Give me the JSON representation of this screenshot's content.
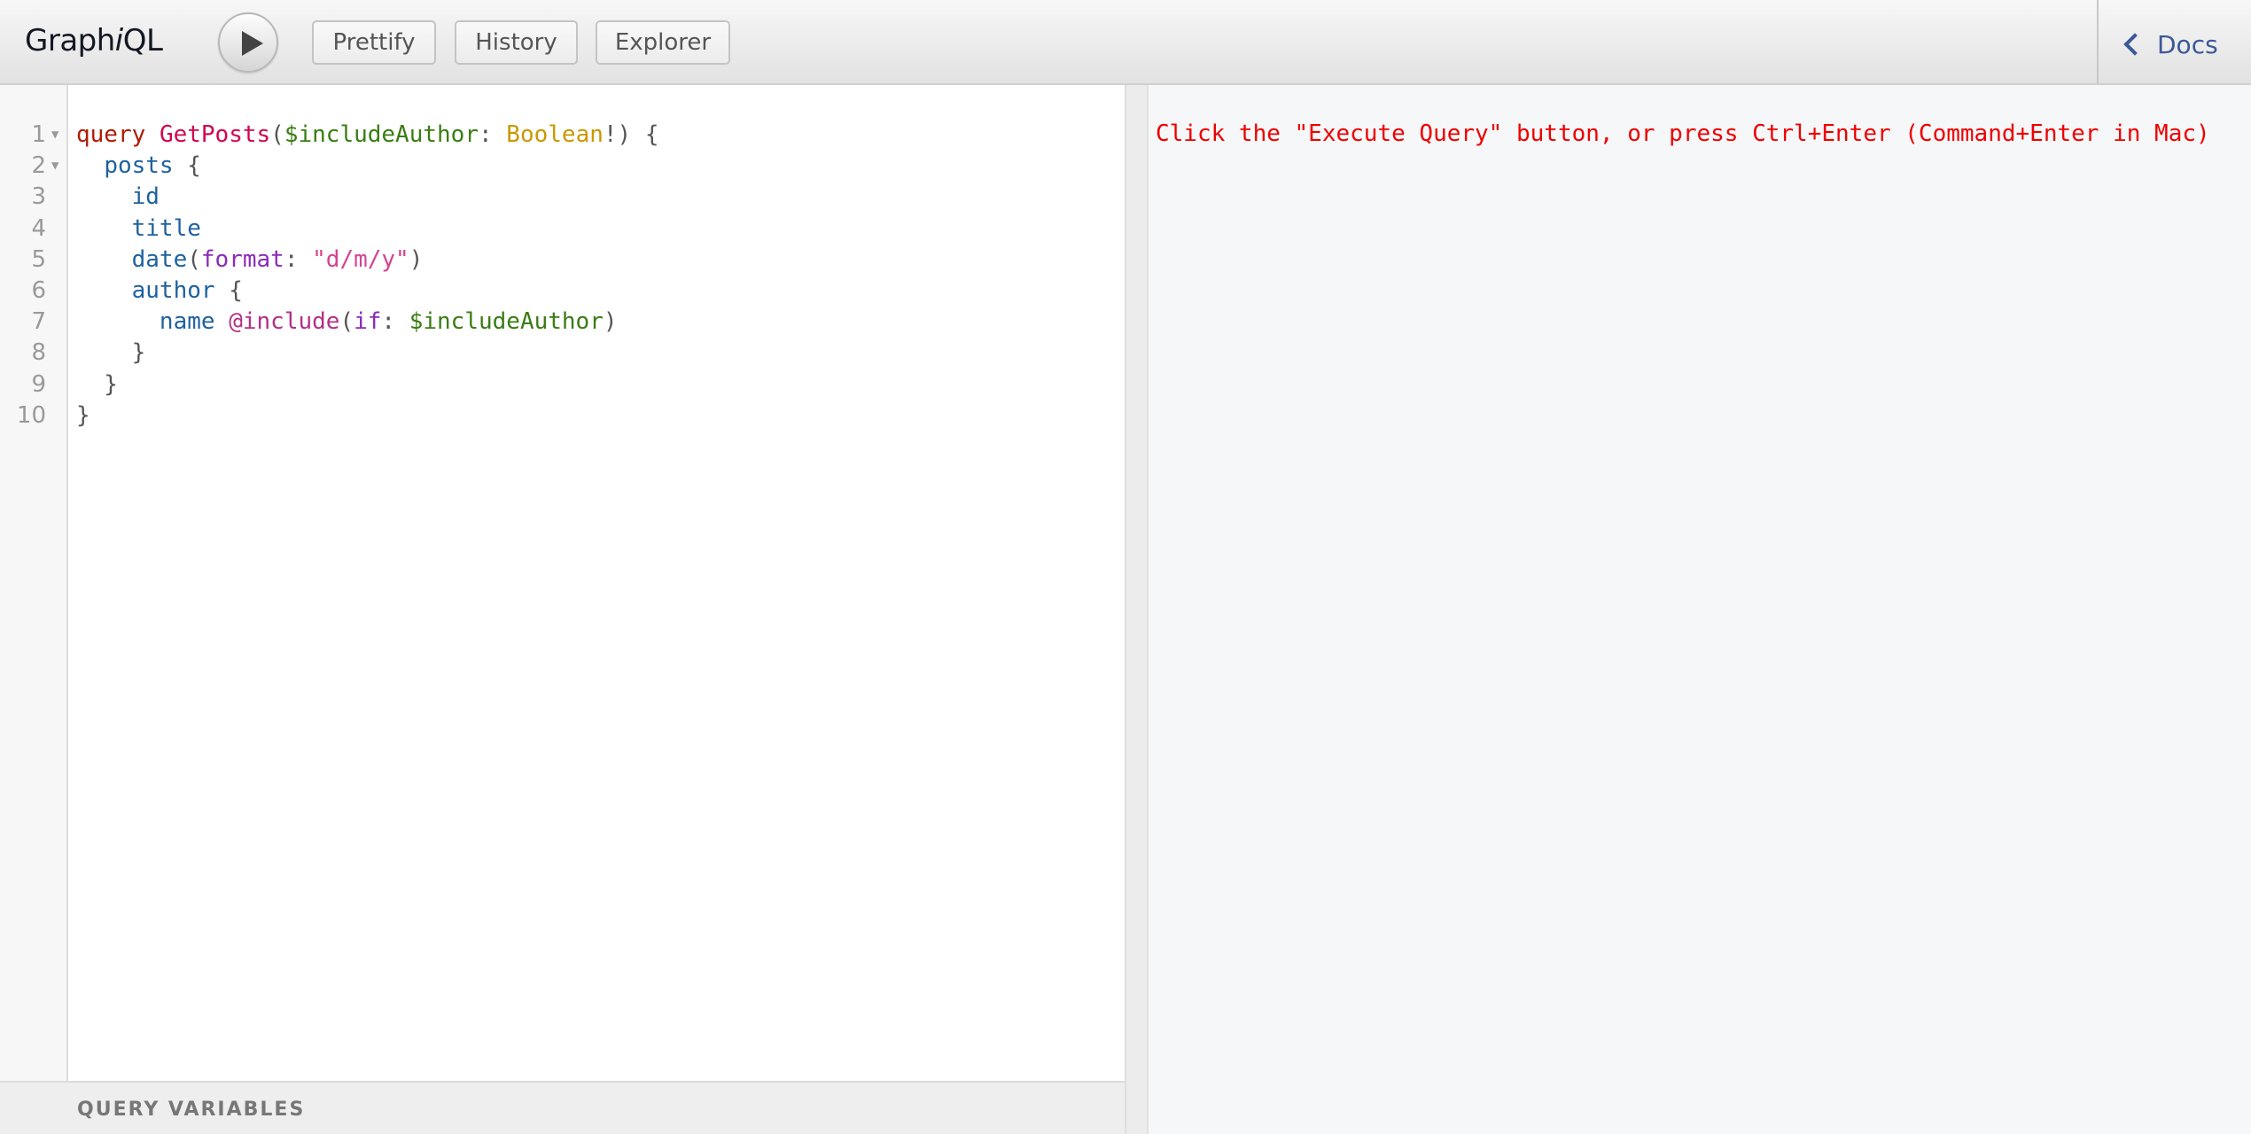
{
  "app": {
    "title_prefix": "Graph",
    "title_italic": "i",
    "title_suffix": "QL"
  },
  "toolbar": {
    "run_button_label": "Execute Query",
    "buttons": [
      {
        "label": "Prettify"
      },
      {
        "label": "History"
      },
      {
        "label": "Explorer"
      }
    ],
    "docs_label": "Docs"
  },
  "editor": {
    "lines": [
      {
        "num": "1",
        "foldable": true,
        "tokens": [
          {
            "t": "query",
            "c": "k-kw"
          },
          {
            "t": " ",
            "c": "k-p"
          },
          {
            "t": "GetPosts",
            "c": "k-def"
          },
          {
            "t": "(",
            "c": "k-p"
          },
          {
            "t": "$includeAuthor",
            "c": "k-var"
          },
          {
            "t": ": ",
            "c": "k-p"
          },
          {
            "t": "Boolean",
            "c": "k-type"
          },
          {
            "t": "!) {",
            "c": "k-p"
          }
        ]
      },
      {
        "num": "2",
        "foldable": true,
        "tokens": [
          {
            "t": "  ",
            "c": "k-p"
          },
          {
            "t": "posts",
            "c": "k-field"
          },
          {
            "t": " {",
            "c": "k-p"
          }
        ]
      },
      {
        "num": "3",
        "foldable": false,
        "tokens": [
          {
            "t": "    ",
            "c": "k-p"
          },
          {
            "t": "id",
            "c": "k-field"
          }
        ]
      },
      {
        "num": "4",
        "foldable": false,
        "tokens": [
          {
            "t": "    ",
            "c": "k-p"
          },
          {
            "t": "title",
            "c": "k-field"
          }
        ]
      },
      {
        "num": "5",
        "foldable": false,
        "tokens": [
          {
            "t": "    ",
            "c": "k-p"
          },
          {
            "t": "date",
            "c": "k-field"
          },
          {
            "t": "(",
            "c": "k-p"
          },
          {
            "t": "format",
            "c": "k-arg"
          },
          {
            "t": ": ",
            "c": "k-p"
          },
          {
            "t": "\"d/m/y\"",
            "c": "k-str"
          },
          {
            "t": ")",
            "c": "k-p"
          }
        ]
      },
      {
        "num": "6",
        "foldable": false,
        "tokens": [
          {
            "t": "    ",
            "c": "k-p"
          },
          {
            "t": "author",
            "c": "k-field"
          },
          {
            "t": " {",
            "c": "k-p"
          }
        ]
      },
      {
        "num": "7",
        "foldable": false,
        "tokens": [
          {
            "t": "      ",
            "c": "k-p"
          },
          {
            "t": "name",
            "c": "k-field"
          },
          {
            "t": " ",
            "c": "k-p"
          },
          {
            "t": "@include",
            "c": "k-dir"
          },
          {
            "t": "(",
            "c": "k-p"
          },
          {
            "t": "if",
            "c": "k-arg"
          },
          {
            "t": ": ",
            "c": "k-p"
          },
          {
            "t": "$includeAuthor",
            "c": "k-var"
          },
          {
            "t": ")",
            "c": "k-p"
          }
        ]
      },
      {
        "num": "8",
        "foldable": false,
        "tokens": [
          {
            "t": "    }",
            "c": "k-p"
          }
        ]
      },
      {
        "num": "9",
        "foldable": false,
        "tokens": [
          {
            "t": "  }",
            "c": "k-p"
          }
        ]
      },
      {
        "num": "10",
        "foldable": false,
        "tokens": [
          {
            "t": "}",
            "c": "k-p"
          }
        ]
      }
    ],
    "fold_glyph": "▼"
  },
  "variables_panel": {
    "label": "QUERY VARIABLES"
  },
  "result": {
    "message": "Click the \"Execute Query\" button, or press Ctrl+Enter (Command+Enter in Mac)"
  },
  "colors": {
    "keyword": "#b11a04",
    "definition": "#d2054e",
    "variable": "#397d13",
    "type": "#ca9800",
    "field": "#1f61a0",
    "argument": "#8b2bb9",
    "string": "#d64292",
    "directive": "#b33086",
    "result_message": "#ee0000",
    "docs_link": "#3b5998"
  }
}
